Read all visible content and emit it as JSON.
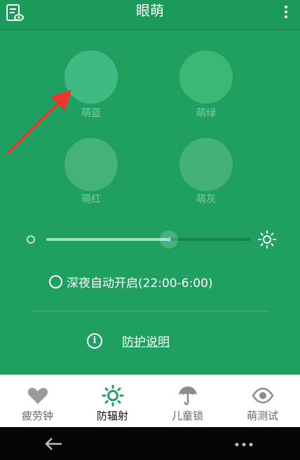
{
  "app": {
    "title": "眼萌"
  },
  "filters": [
    {
      "label": "萌蓝",
      "color": "#3fba83"
    },
    {
      "label": "萌绿",
      "color": "#3bb873"
    },
    {
      "label": "萌红",
      "color": "#45b27c"
    },
    {
      "label": "萌灰",
      "color": "#44b07a"
    }
  ],
  "brightness": {
    "value": 0.6
  },
  "night_mode": {
    "label": "深夜自动开启(22:00-6:00)",
    "checked": false
  },
  "protection": {
    "link_label": "防护说明"
  },
  "tabs": [
    {
      "label": "疲劳钟",
      "icon": "heart-icon"
    },
    {
      "label": "防辐射",
      "icon": "sun-icon",
      "active": true
    },
    {
      "label": "儿童锁",
      "icon": "umbrella-icon"
    },
    {
      "label": "萌测试",
      "icon": "eye-icon"
    }
  ],
  "colors": {
    "theme_green": "#1f9f60",
    "accent_red": "#f2332a"
  }
}
